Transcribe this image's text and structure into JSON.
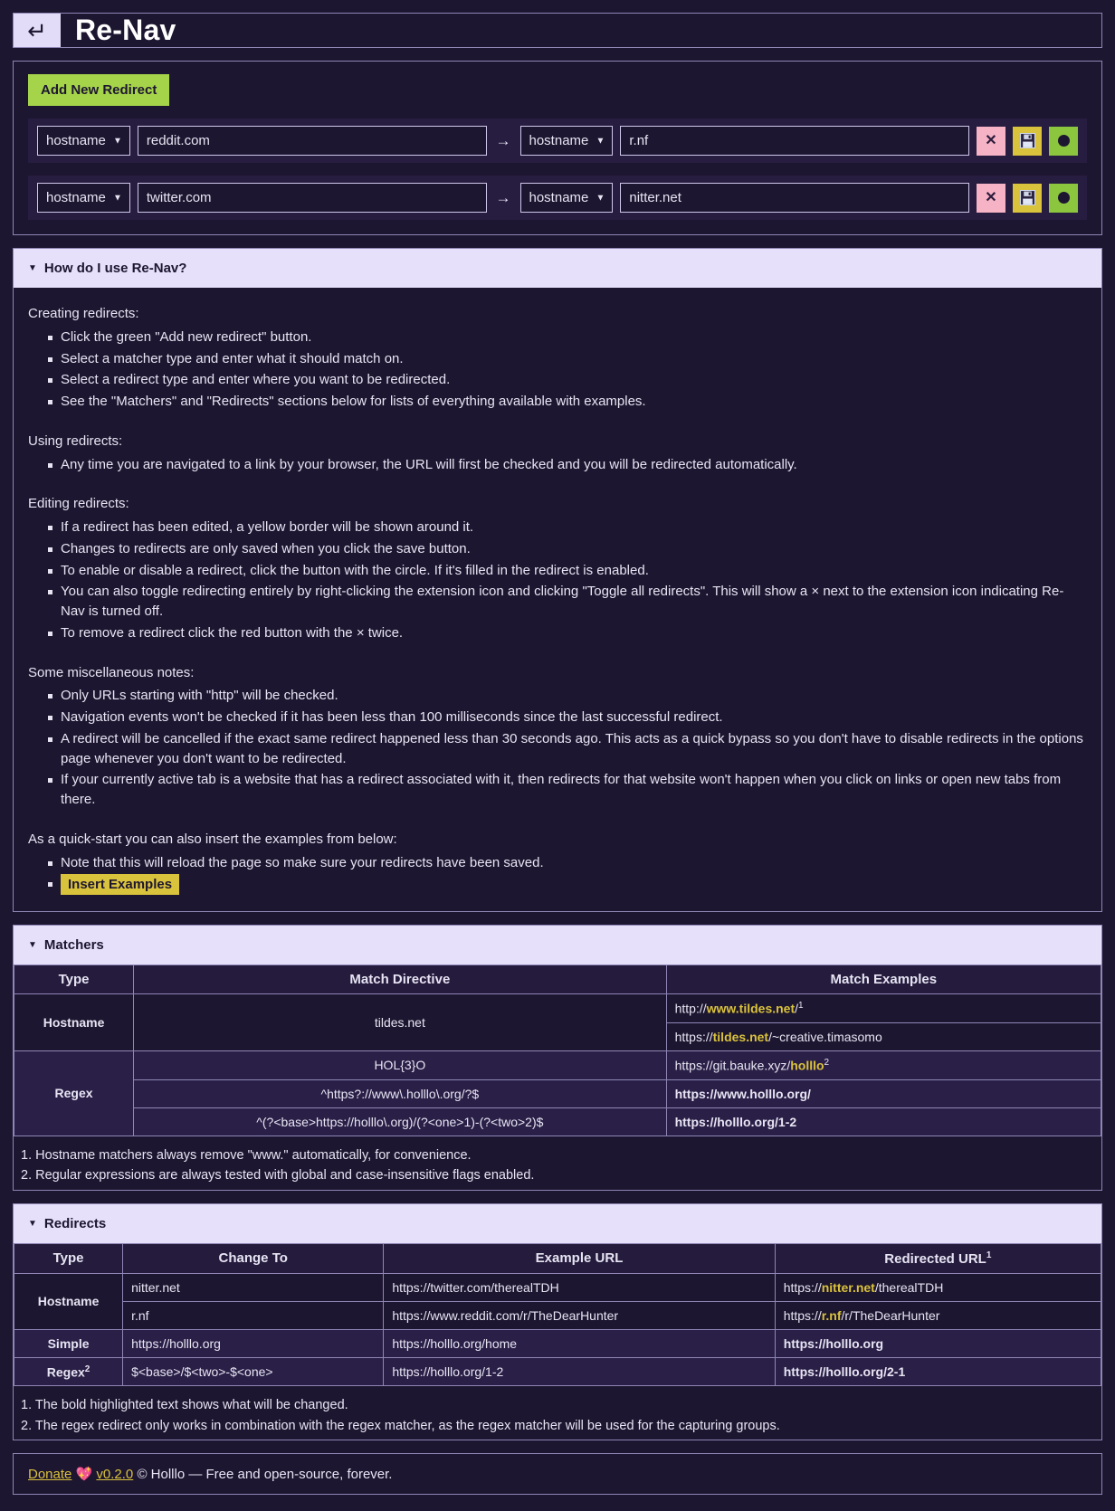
{
  "header": {
    "title": "Re-Nav",
    "icon": "return-arrow-icon"
  },
  "editor": {
    "add_label": "Add New Redirect",
    "arrow": "→",
    "caret": "▼",
    "delete_glyph": "✕",
    "save_glyph": "💾",
    "rows": [
      {
        "matcher_type": "hostname",
        "matcher_value": "reddit.com",
        "redirect_type": "hostname",
        "redirect_value": "r.nf"
      },
      {
        "matcher_type": "hostname",
        "matcher_value": "twitter.com",
        "redirect_type": "hostname",
        "redirect_value": "nitter.net"
      }
    ]
  },
  "help": {
    "title": "How do I use Re-Nav?",
    "triangle": "▼",
    "creating_label": "Creating redirects:",
    "creating_items": [
      "Click the green \"Add new redirect\" button.",
      "Select a matcher type and enter what it should match on.",
      "Select a redirect type and enter where you want to be redirected.",
      "See the \"Matchers\" and \"Redirects\" sections below for lists of everything available with examples."
    ],
    "using_label": "Using redirects:",
    "using_items": [
      "Any time you are navigated to a link by your browser, the URL will first be checked and you will be redirected automatically."
    ],
    "editing_label": "Editing redirects:",
    "editing_items": [
      "If a redirect has been edited, a yellow border will be shown around it.",
      "Changes to redirects are only saved when you click the save button.",
      "To enable or disable a redirect, click the button with the circle. If it's filled in the redirect is enabled.",
      "You can also toggle redirecting entirely by right-clicking the extension icon and clicking \"Toggle all redirects\". This will show a × next to the extension icon indicating Re-Nav is turned off.",
      "To remove a redirect click the red button with the × twice."
    ],
    "misc_label": "Some miscellaneous notes:",
    "misc_items": [
      "Only URLs starting with \"http\" will be checked.",
      "Navigation events won't be checked if it has been less than 100 milliseconds since the last successful redirect.",
      "A redirect will be cancelled if the exact same redirect happened less than 30 seconds ago. This acts as a quick bypass so you don't have to disable redirects in the options page whenever you don't want to be redirected.",
      "If your currently active tab is a website that has a redirect associated with it, then redirects for that website won't happen when you click on links or open new tabs from there."
    ],
    "quickstart_label": "As a quick-start you can also insert the examples from below:",
    "quickstart_note": "Note that this will reload the page so make sure your redirects have been saved.",
    "insert_examples_label": "Insert Examples"
  },
  "matchers": {
    "title": "Matchers",
    "triangle": "▼",
    "columns": [
      "Type",
      "Match Directive",
      "Match Examples"
    ],
    "hostname_type": "Hostname",
    "regex_type": "Regex",
    "hostname_directive": "tildes.net",
    "hostname_examples": [
      {
        "pre": "http://",
        "hl": "www.tildes.net",
        "post": "/",
        "sup": "1"
      },
      {
        "pre": "https://",
        "hl": "tildes.net",
        "post": "/~creative.timasomo",
        "sup": ""
      }
    ],
    "regex_rows": [
      {
        "directive": "HOL{3}O",
        "example": {
          "pre": "https://git.bauke.xyz/",
          "hl": "holllo",
          "post": "",
          "sup": "2",
          "allbold": false
        }
      },
      {
        "directive": "^https?://www\\.holllo\\.org/?$",
        "example": {
          "pre": "",
          "hl": "https://www.holllo.org/",
          "post": "",
          "sup": "",
          "allbold": true
        }
      },
      {
        "directive": "^(?<base>https://holllo\\.org)/(?<one>1)-(?<two>2)$",
        "example": {
          "pre": "",
          "hl": "https://holllo.org/1-2",
          "post": "",
          "sup": "",
          "allbold": true
        }
      }
    ],
    "notes": [
      "1. Hostname matchers always remove \"www.\" automatically, for convenience.",
      "2. Regular expressions are always tested with global and case-insensitive flags enabled."
    ]
  },
  "redirects": {
    "title": "Redirects",
    "triangle": "▼",
    "columns": [
      "Type",
      "Change To",
      "Example URL",
      "Redirected URL"
    ],
    "columns_sup": [
      "",
      "",
      "",
      "1"
    ],
    "hostname_type": "Hostname",
    "simple_type": "Simple",
    "regex_type": "Regex",
    "regex_type_sup": "2",
    "hostname_rows": [
      {
        "change_to": "nitter.net",
        "example": "https://twitter.com/therealTDH",
        "redirected": {
          "pre": "https://",
          "hl": "nitter.net",
          "post": "/therealTDH",
          "allbold": false
        }
      },
      {
        "change_to": "r.nf",
        "example": "https://www.reddit.com/r/TheDearHunter",
        "redirected": {
          "pre": "https://",
          "hl": "r.nf",
          "post": "/r/TheDearHunter",
          "allbold": false
        }
      }
    ],
    "simple_row": {
      "change_to": "https://holllo.org",
      "example": "https://holllo.org/home",
      "redirected": {
        "pre": "",
        "hl": "https://holllo.org",
        "post": "",
        "allbold": true
      }
    },
    "regex_row": {
      "change_to": "$<base>/$<two>-$<one>",
      "example": "https://holllo.org/1-2",
      "redirected": {
        "pre": "",
        "hl": "https://holllo.org/2-1",
        "post": "",
        "allbold": true
      }
    },
    "notes": [
      "1. The bold highlighted text shows what will be changed.",
      "2. The regex redirect only works in combination with the regex matcher, as the regex matcher will be used for the capturing groups."
    ]
  },
  "footer": {
    "donate_label": "Donate",
    "heart": "💖",
    "version": "v0.2.0",
    "text": "© Holllo — Free and open-source, forever."
  }
}
